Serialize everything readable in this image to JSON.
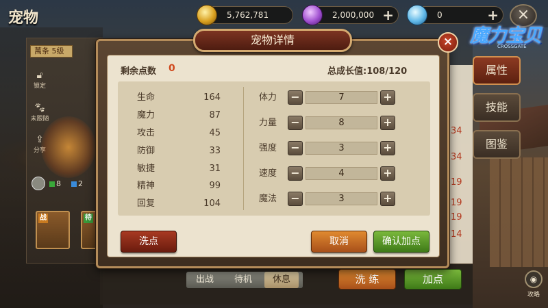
{
  "screen_title": "宠物",
  "resources": [
    {
      "icon": "gold-coin-icon",
      "value": "5,762,781"
    },
    {
      "icon": "purple-gem-icon",
      "value": "2,000,000"
    },
    {
      "icon": "diamond-icon",
      "value": "0"
    }
  ],
  "logo": {
    "text": "魔力宝贝",
    "sub": "CROSSGATE"
  },
  "left_panel": {
    "level_tag": "萬条 5级",
    "buttons": [
      {
        "icon": "lock-icon",
        "label": "锁定"
      },
      {
        "icon": "paw-icon",
        "label": "未跟随"
      },
      {
        "icon": "share-icon",
        "label": "分享"
      }
    ],
    "mini_stats": [
      "8",
      "2"
    ],
    "slots": [
      {
        "tag": "战",
        "color": "#c87a20"
      },
      {
        "tag": "待",
        "color": "#3a9a3a"
      }
    ]
  },
  "right_tabs": [
    "属性",
    "技能",
    "图鉴"
  ],
  "bg_numbers": [
    "34",
    "34",
    "19",
    "19",
    "19",
    "14"
  ],
  "guide_label": "攻略",
  "bottom_tabs": [
    "出战",
    "待机",
    "休息"
  ],
  "bottom_buttons": {
    "wash": "洗 练",
    "add": "加点"
  },
  "dialog": {
    "title": "宠物详情",
    "remain_label": "剩余点数",
    "remain_value": "0",
    "growth": "总成长值:108/120",
    "stats": [
      {
        "name": "生命",
        "value": "164"
      },
      {
        "name": "魔力",
        "value": "87"
      },
      {
        "name": "攻击",
        "value": "45"
      },
      {
        "name": "防御",
        "value": "33"
      },
      {
        "name": "敏捷",
        "value": "31"
      },
      {
        "name": "精神",
        "value": "99"
      },
      {
        "name": "回复",
        "value": "104"
      }
    ],
    "allocations": [
      {
        "name": "体力",
        "value": "7"
      },
      {
        "name": "力量",
        "value": "8"
      },
      {
        "name": "强度",
        "value": "3"
      },
      {
        "name": "速度",
        "value": "4"
      },
      {
        "name": "魔法",
        "value": "3"
      }
    ],
    "minus_glyph": "−",
    "plus_glyph": "+",
    "reset_label": "洗点",
    "cancel_label": "取消",
    "confirm_label": "确认加点",
    "close_glyph": "×"
  },
  "colors": {
    "accent_red": "#d0481c",
    "confirm_green": "#5a9a2a",
    "cancel_orange": "#c87028",
    "reset_red": "#8a2a16"
  }
}
